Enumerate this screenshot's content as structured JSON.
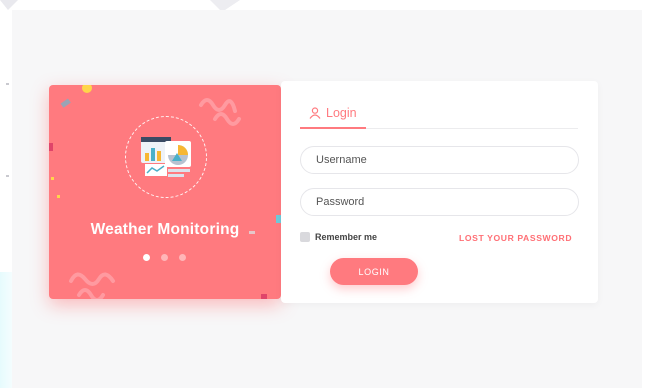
{
  "promo": {
    "title": "Weather Monitoring",
    "illustration_icon": "analytics-dashboard-icon",
    "carousel_dots": 3,
    "active_dot": 1
  },
  "login": {
    "tab_label": "Login",
    "tab_icon": "user-icon",
    "username_placeholder": "Username",
    "password_placeholder": "Password",
    "remember_label": "Remember me",
    "lost_password_label": "LOST YOUR PASSWORD",
    "submit_label": "LOGIN"
  },
  "colors": {
    "accent": "#ff7a7f",
    "page_background": "#f7f7f8",
    "card_background": "#ffffff"
  }
}
